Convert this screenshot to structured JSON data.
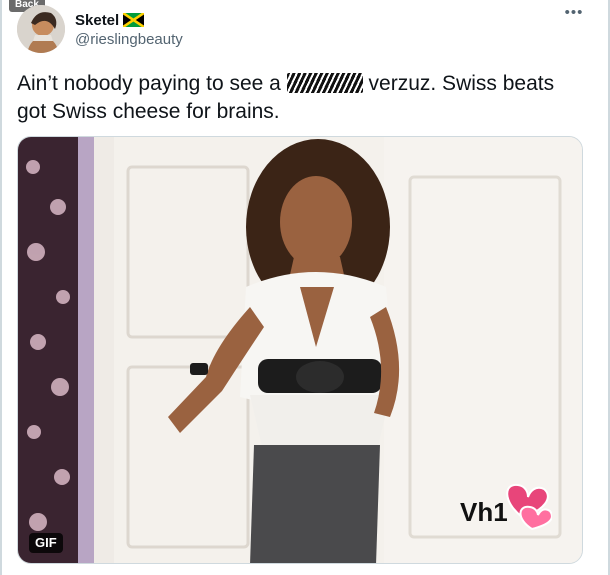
{
  "nav": {
    "back_label": "Back"
  },
  "tweet": {
    "author": {
      "display_name": "Sketel",
      "handle": "@rieslingbeauty",
      "flag_icon": "jamaica-flag-icon"
    },
    "more_icon": "more-horizontal-icon",
    "text_before": "Ain’t nobody paying to see a ",
    "text_after": " verzuz. Swiss beats got Swiss cheese for brains.",
    "censored_word_note": "scribbled-out-word",
    "media": {
      "badge": "GIF",
      "watermark": "Vh1"
    }
  },
  "colors": {
    "text_primary": "#0f1419",
    "text_secondary": "#536471",
    "border": "#cfd9de",
    "watermark_heart": "#e8457a"
  }
}
